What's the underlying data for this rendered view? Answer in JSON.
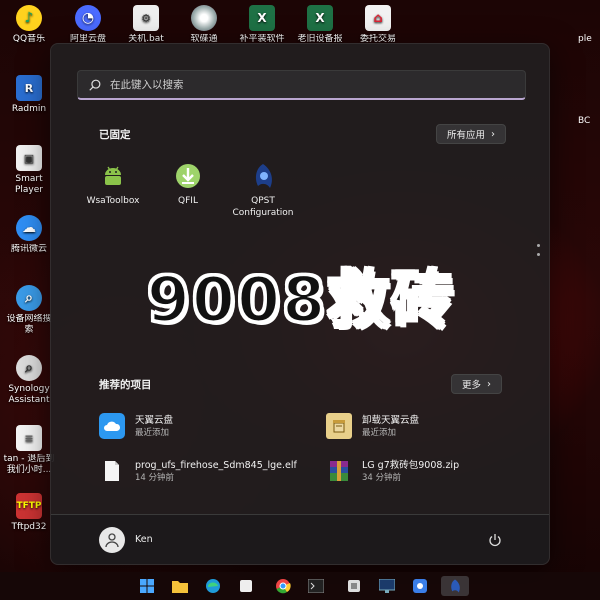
{
  "desktop": {
    "icons": [
      {
        "label": "QQ音乐"
      },
      {
        "label": "阿里云盘"
      },
      {
        "label": "关机.bat"
      },
      {
        "label": "软碟通"
      },
      {
        "label": "补平装软件"
      },
      {
        "label": "老旧设备报"
      },
      {
        "label": "委托交易"
      },
      {
        "label": "Radmin"
      },
      {
        "label": "Smart Player"
      },
      {
        "label": "腾讯微云"
      },
      {
        "label": "设备网络搜索"
      },
      {
        "label": "Synology Assistant"
      },
      {
        "label": "tan - 退后到我们小时..."
      },
      {
        "label": "Tftpd32"
      }
    ],
    "right_edge_text": [
      "ple",
      "BC"
    ]
  },
  "start_menu": {
    "search_placeholder": "在此键入以搜索",
    "pinned": {
      "title": "已固定",
      "all_apps_label": "所有应用",
      "apps": [
        {
          "name": "WsaToolbox",
          "icon": "android-icon"
        },
        {
          "name": "QFIL",
          "icon": "download-icon"
        },
        {
          "name": "QPST Configuration",
          "icon": "qpst-icon"
        }
      ]
    },
    "overlay_title": "9008救砖",
    "recommended": {
      "title": "推荐的项目",
      "more_label": "更多",
      "items": [
        {
          "name": "天翼云盘",
          "sub": "最近添加",
          "icon": "cloud-app-icon"
        },
        {
          "name": "卸载天翼云盘",
          "sub": "最近添加",
          "icon": "uninstall-icon"
        },
        {
          "name": "prog_ufs_firehose_Sdm845_lge.elf",
          "sub": "14 分钟前",
          "icon": "file-icon"
        },
        {
          "name": "LG g7救砖包9008.zip",
          "sub": "34 分钟前",
          "icon": "winrar-icon"
        }
      ]
    },
    "user": {
      "name": "Ken"
    }
  },
  "taskbar": {
    "icons": [
      "windows-start-icon",
      "file-explorer-icon",
      "edge-icon",
      "app-icon",
      "chrome-icon",
      "terminal-icon",
      "app-icon-2",
      "monitor-icon",
      "app-icon-3",
      "qpst-taskbar-icon"
    ]
  },
  "colors": {
    "accent": "#b9a6d0",
    "menu_bg": "#221e20",
    "wallpaper": "#4a0707"
  }
}
